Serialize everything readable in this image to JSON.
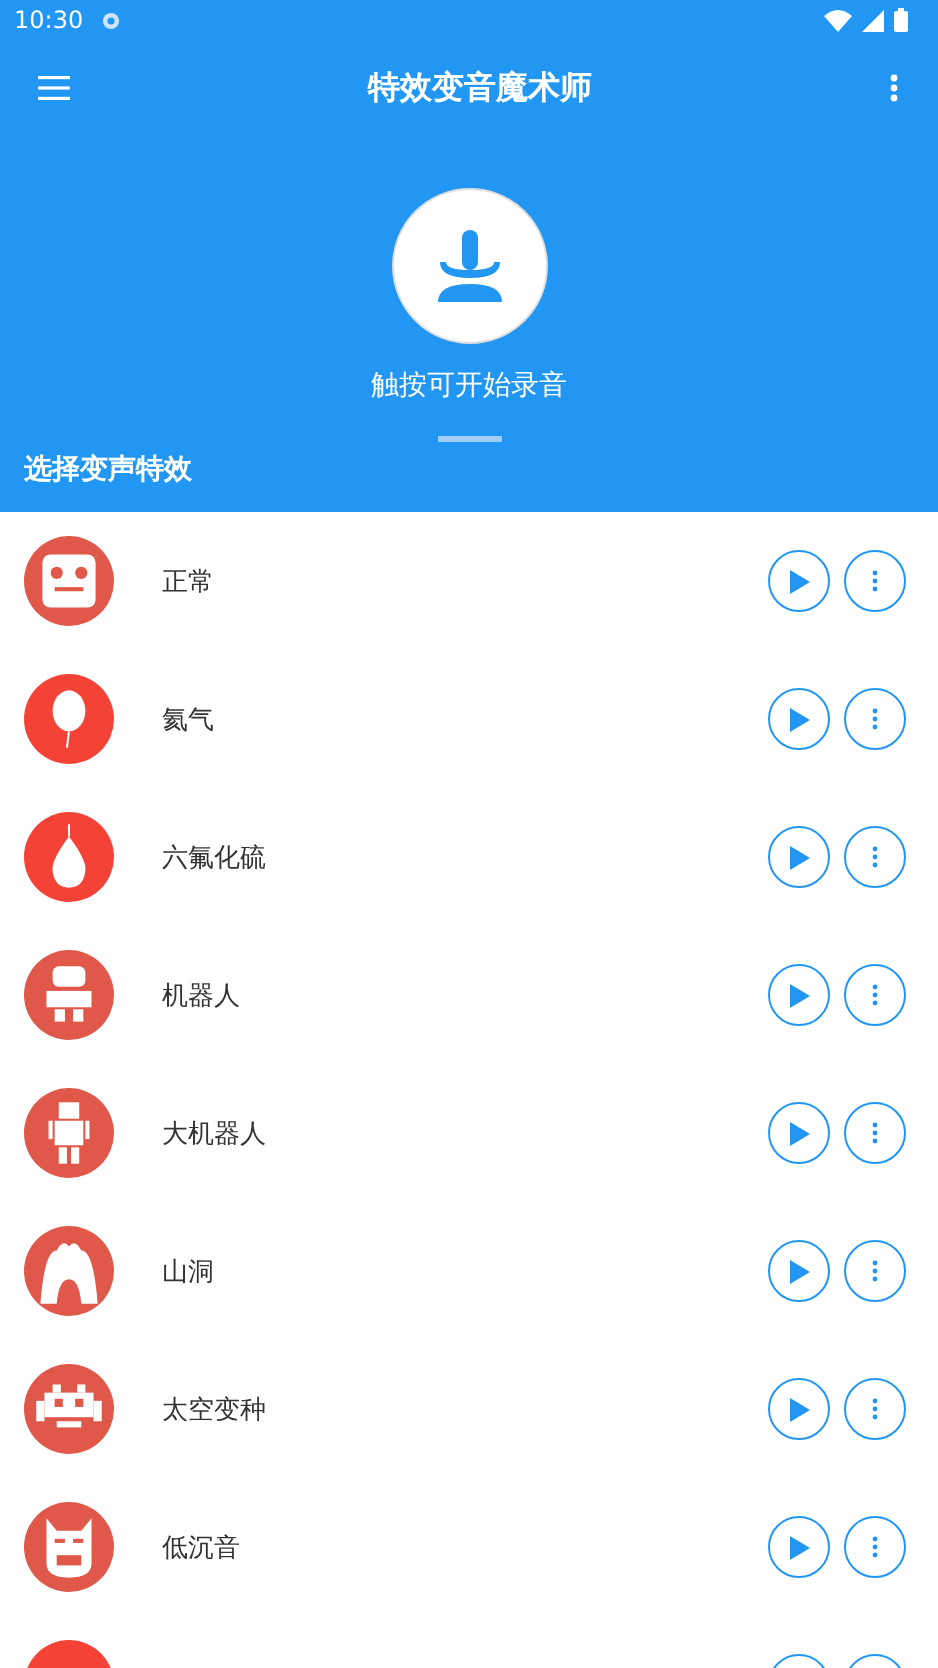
{
  "status_bar": {
    "time": "10:30"
  },
  "toolbar": {
    "title": "特效变音魔术师"
  },
  "record": {
    "hint": "触按可开始录音"
  },
  "section_title": "选择变声特效",
  "effects": [
    {
      "kind": "face",
      "label": "正常",
      "color": "#e0584a"
    },
    {
      "kind": "balloon",
      "label": "氦气",
      "color": "#f44336"
    },
    {
      "kind": "drop",
      "label": "六氟化硫",
      "color": "#f44336"
    },
    {
      "kind": "robot",
      "label": "机器人",
      "color": "#e0584a"
    },
    {
      "kind": "tall-robot",
      "label": "大机器人",
      "color": "#e0584a"
    },
    {
      "kind": "cave",
      "label": "山洞",
      "color": "#e0584a"
    },
    {
      "kind": "invader",
      "label": "太空变种",
      "color": "#e0584a"
    },
    {
      "kind": "mask",
      "label": "低沉音",
      "color": "#e0584a"
    },
    {
      "kind": "partial",
      "color": "#f44336"
    }
  ]
}
